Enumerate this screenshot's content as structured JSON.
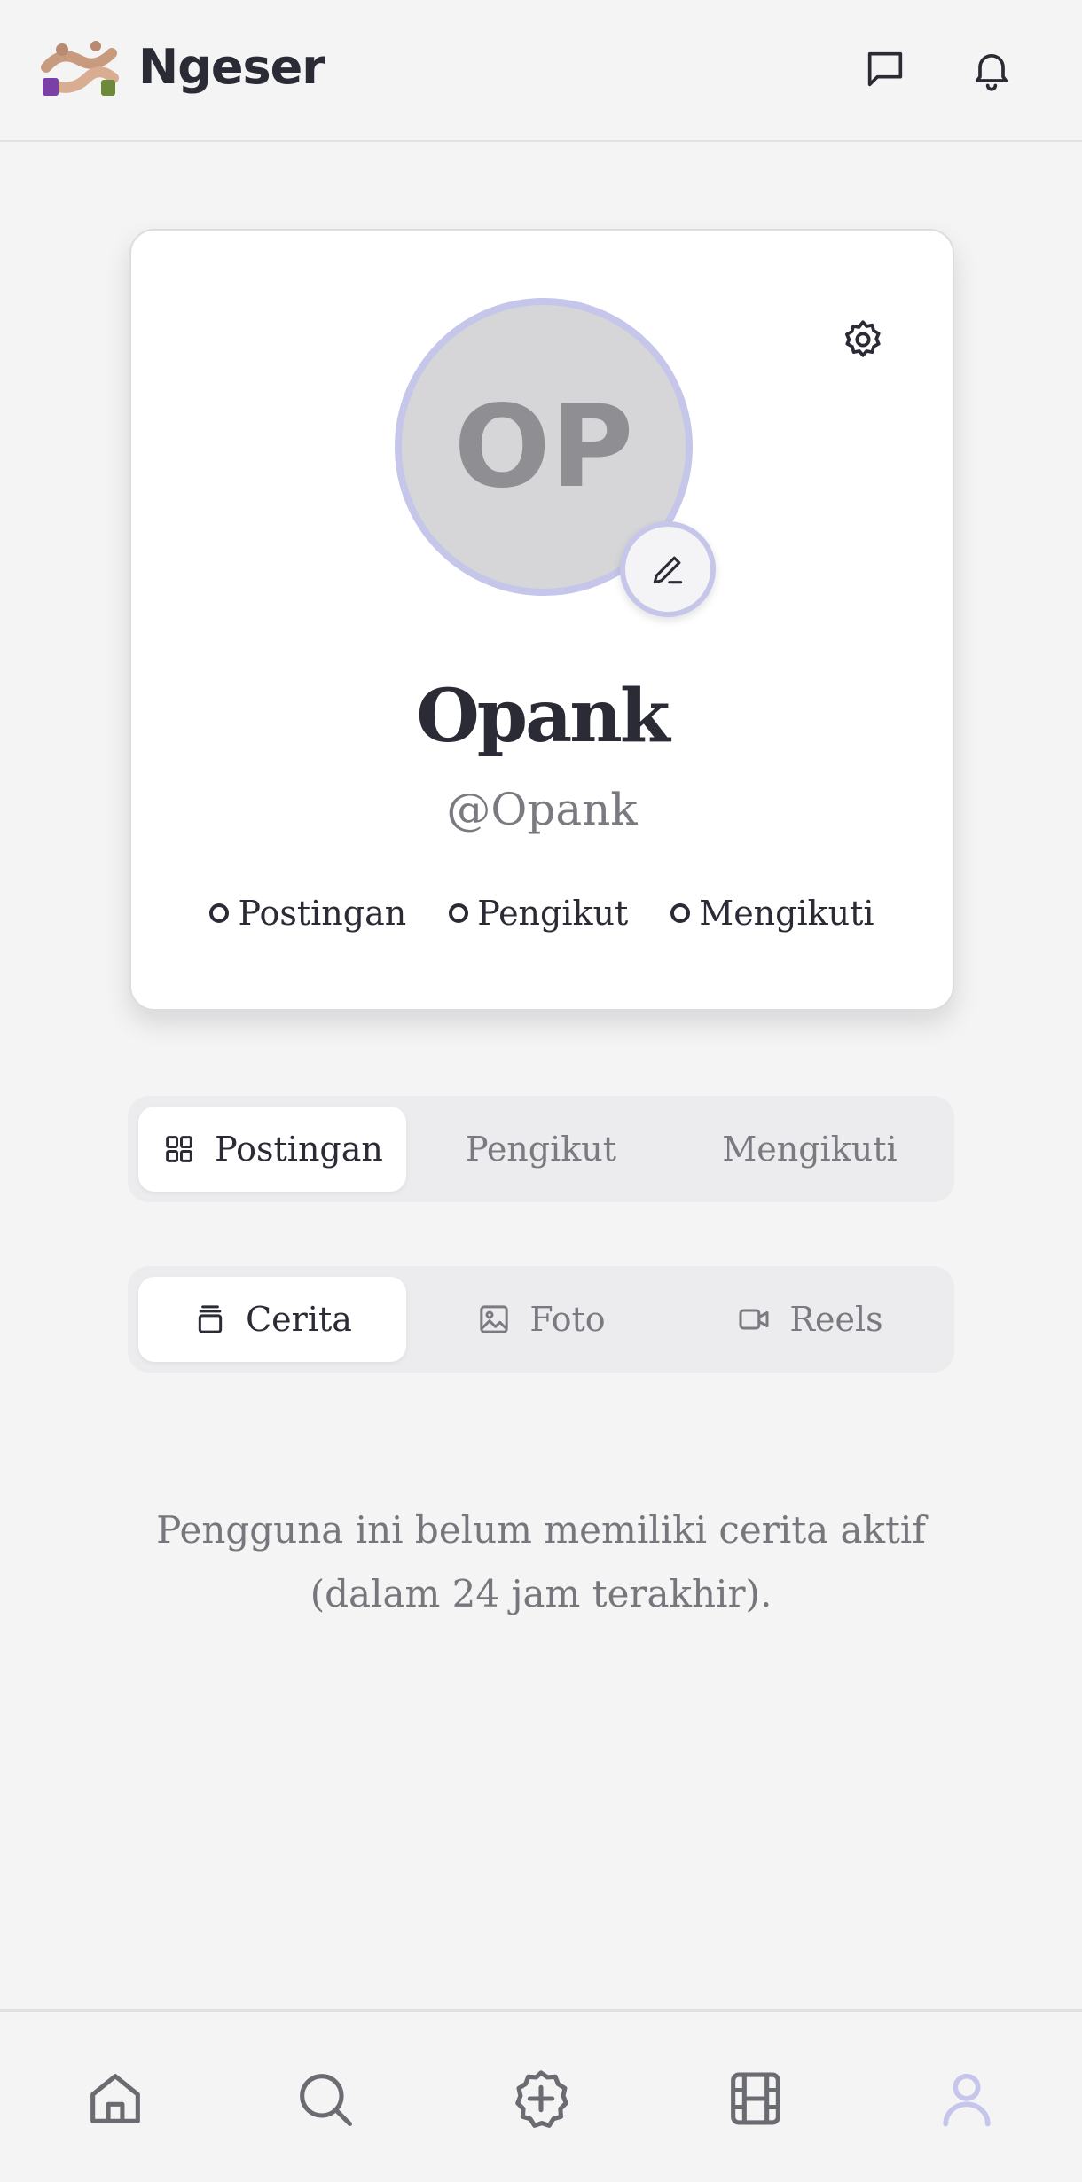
{
  "app": {
    "name": "Ngeser"
  },
  "profile": {
    "initials": "OP",
    "name": "Opank",
    "handle": "@Opank",
    "stats": [
      {
        "label": "Postingan"
      },
      {
        "label": "Pengikut"
      },
      {
        "label": "Mengikuti"
      }
    ]
  },
  "main_tabs": [
    {
      "label": "Postingan",
      "icon": "grid-icon",
      "active": true
    },
    {
      "label": "Pengikut",
      "active": false
    },
    {
      "label": "Mengikuti",
      "active": false
    }
  ],
  "sub_tabs": [
    {
      "label": "Cerita",
      "icon": "stack-icon",
      "active": true
    },
    {
      "label": "Foto",
      "icon": "image-icon",
      "active": false
    },
    {
      "label": "Reels",
      "icon": "video-icon",
      "active": false
    }
  ],
  "empty_state": {
    "line1": "Pengguna ini belum memiliki cerita aktif",
    "line2": "(dalam 24 jam terakhir)."
  },
  "bottom_nav": [
    {
      "name": "home-icon",
      "active": false
    },
    {
      "name": "search-icon",
      "active": false
    },
    {
      "name": "create-icon",
      "active": false
    },
    {
      "name": "reels-icon",
      "active": false
    },
    {
      "name": "profile-icon",
      "active": true
    }
  ],
  "colors": {
    "accent": "#c5c6ea",
    "background": "#f4f4f5",
    "text": "#2b2b36",
    "muted": "#7a7a80"
  }
}
